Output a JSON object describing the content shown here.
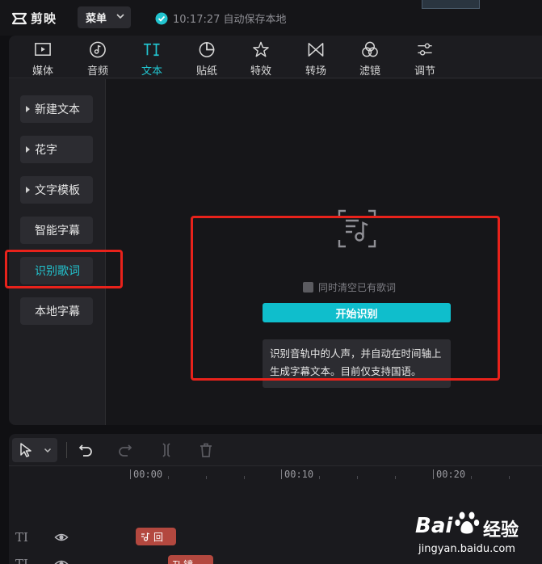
{
  "app": {
    "logo_text": "剪映",
    "menu_label": "菜单",
    "save_status": "10:17:27 自动保存本地"
  },
  "toolbar": {
    "tabs": [
      {
        "label": "媒体",
        "icon": "media-icon"
      },
      {
        "label": "音频",
        "icon": "audio-icon"
      },
      {
        "label": "文本",
        "icon": "text-icon",
        "active": true
      },
      {
        "label": "贴纸",
        "icon": "sticker-icon"
      },
      {
        "label": "特效",
        "icon": "effects-icon"
      },
      {
        "label": "转场",
        "icon": "transition-icon"
      },
      {
        "label": "滤镜",
        "icon": "filter-icon"
      },
      {
        "label": "调节",
        "icon": "adjust-icon"
      }
    ]
  },
  "sidebar": {
    "items": [
      {
        "label": "新建文本",
        "has_arrow": true
      },
      {
        "label": "花字",
        "has_arrow": true
      },
      {
        "label": "文字模板",
        "has_arrow": true
      },
      {
        "label": "智能字幕",
        "has_arrow": false
      },
      {
        "label": "识别歌词",
        "has_arrow": false,
        "active": true
      },
      {
        "label": "本地字幕",
        "has_arrow": false
      }
    ]
  },
  "lyrics": {
    "clear_option": "同时清空已有歌词",
    "start_button": "开始识别",
    "description": "识别音轨中的人声，并自动在时间轴上生成字幕文本。目前仅支持国语。"
  },
  "timeline": {
    "ticks": [
      "00:00",
      "00:10",
      "00:20"
    ],
    "track_icon": "TI",
    "clip1_label": "回",
    "clip2_label": "镜"
  },
  "watermark": {
    "brand": "Bai",
    "brand_suffix": "经验",
    "url": "jingyan.baidu.com"
  },
  "colors": {
    "accent": "#22c4cf",
    "button": "#0fbecc",
    "highlight_box": "#e8221b",
    "clip": "#b3483f"
  }
}
